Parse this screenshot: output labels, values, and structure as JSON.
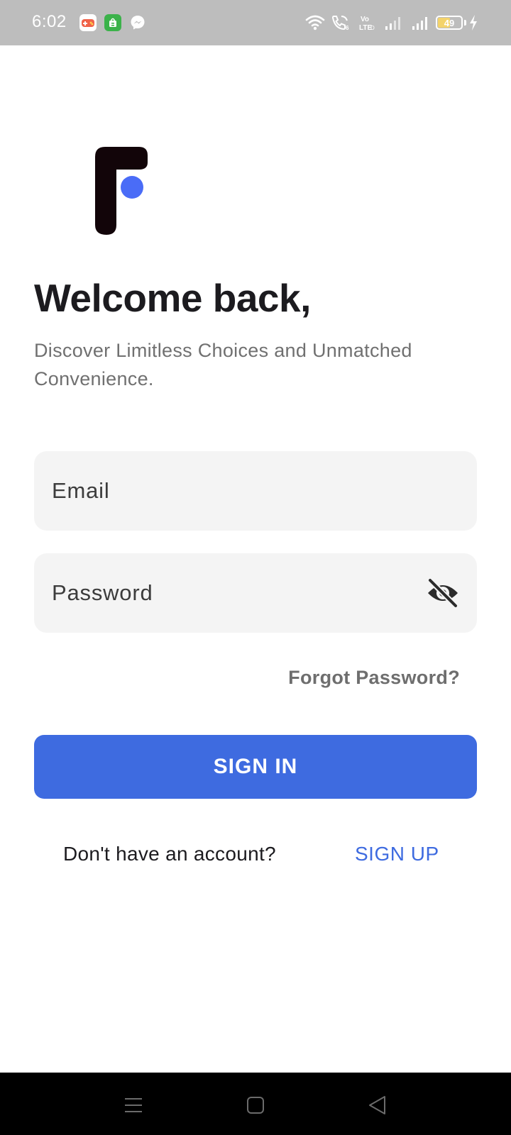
{
  "status_bar": {
    "time": "6:02",
    "battery_level": "49",
    "battery_fraction": 0.49,
    "icons": [
      "game-app-icon",
      "store-app-icon",
      "messenger-icon",
      "wifi-icon",
      "wifi-calling-icon",
      "volte-icon",
      "signal-icon",
      "signal-icon",
      "battery-icon",
      "charging-icon"
    ]
  },
  "login": {
    "logo_icon": "brand-logo-icon",
    "title": "Welcome back,",
    "subtitle": "Discover Limitless Choices and Unmatched Convenience.",
    "email_placeholder": "Email",
    "email_value": "",
    "password_placeholder": "Password",
    "password_value": "",
    "password_toggle_icon": "eye-off-icon",
    "forgot_password": "Forgot Password?",
    "sign_in_label": "SIGN IN",
    "signup_prompt": "Don't have an account?",
    "signup_label": "SIGN UP"
  },
  "colors": {
    "accent": "#3e6be0",
    "logo_dot": "#4a6cf7",
    "field_bg": "#f4f4f4",
    "status_bar_bg": "#bdbdbd"
  },
  "nav_bar": {
    "buttons": [
      "menu-icon",
      "home-icon",
      "back-icon"
    ]
  }
}
